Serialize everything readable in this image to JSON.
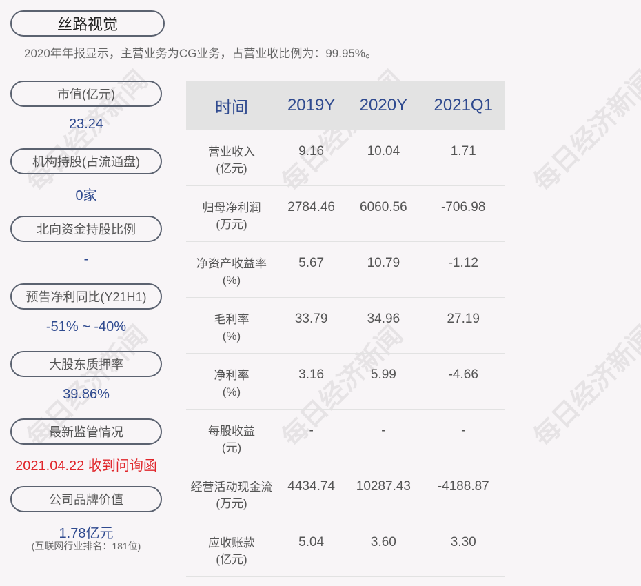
{
  "company": "丝路视觉",
  "summary": "2020年年报显示，主营业务为CG业务，占营业收比例为：99.95%。",
  "metrics": [
    {
      "label": "市值(亿元)",
      "value": "23.24"
    },
    {
      "label": "机构持股(占流通盘)",
      "value": "0家"
    },
    {
      "label": "北向资金持股比例",
      "value": "-"
    },
    {
      "label": "预告净利同比(Y21H1)",
      "value": "-51% ~ -40%"
    },
    {
      "label": "大股东质押率",
      "value": "39.86%"
    },
    {
      "label": "最新监管情况",
      "value": "2021.04.22 收到问询函"
    },
    {
      "label": "公司品牌价值",
      "value": "1.78亿元",
      "note": "(互联网行业排名：181位)"
    }
  ],
  "table": {
    "headers": [
      "时间",
      "2019Y",
      "2020Y",
      "2021Q1"
    ],
    "rows": [
      {
        "l1": "营业收入",
        "l2": "(亿元)",
        "v": [
          "9.16",
          "10.04",
          "1.71"
        ]
      },
      {
        "l1": "归母净利润",
        "l2": "(万元)",
        "v": [
          "2784.46",
          "6060.56",
          "-706.98"
        ]
      },
      {
        "l1": "净资产收益率",
        "l2": "(%)",
        "v": [
          "5.67",
          "10.79",
          "-1.12"
        ]
      },
      {
        "l1": "毛利率",
        "l2": "(%)",
        "v": [
          "33.79",
          "34.96",
          "27.19"
        ]
      },
      {
        "l1": "净利率",
        "l2": "(%)",
        "v": [
          "3.16",
          "5.99",
          "-4.66"
        ]
      },
      {
        "l1": "每股收益",
        "l2": "(元)",
        "v": [
          "-",
          "-",
          "-"
        ]
      },
      {
        "l1": "经营活动现金流",
        "l2": "(万元)",
        "v": [
          "4434.74",
          "10287.43",
          "-4188.87"
        ]
      },
      {
        "l1": "应收账款",
        "l2": "(亿元)",
        "v": [
          "5.04",
          "3.60",
          "3.30"
        ]
      }
    ]
  },
  "watermark": "每日经济新闻",
  "colors": {
    "accent": "#2f4a8f",
    "alert": "#e0262b"
  }
}
